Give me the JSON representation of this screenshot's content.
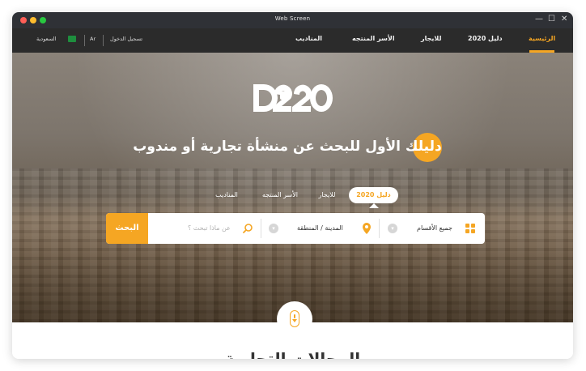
{
  "window": {
    "title": "Web Screen",
    "controls": {
      "minimize": "—",
      "maximize": "☐",
      "close": "✕"
    },
    "traffic_lights": {
      "red": "#ff5f57",
      "yellow": "#febc2e",
      "green": "#28c840"
    }
  },
  "nav": {
    "items": [
      {
        "label": "الرئيسية",
        "active": true
      },
      {
        "label": "دليل 2020",
        "active": false
      },
      {
        "label": "للايجار",
        "active": false
      },
      {
        "label": "الأسر المنتجه",
        "active": false
      },
      {
        "label": "المناديب",
        "active": false
      }
    ],
    "login": "تسجيل الدخول",
    "language": "Ar",
    "country": "السعودية"
  },
  "hero": {
    "logo_text": "D2020",
    "headline": "دليلك الأول للبحث عن منشأة تجارية أو مندوب",
    "tabs": [
      {
        "label": "دليل 2020",
        "active": true
      },
      {
        "label": "للايجار",
        "active": false
      },
      {
        "label": "الأسر المنتجه",
        "active": false
      },
      {
        "label": "المناديب",
        "active": false
      }
    ]
  },
  "search": {
    "categories": "جميع الأقسام",
    "city": "المدينة / المنطقة",
    "placeholder": "عن ماذا تبحث ؟",
    "button": "البحث"
  },
  "section": {
    "title": "المجالات التجارية"
  },
  "colors": {
    "accent": "#f5a623",
    "nav_bg": "#2b2b2b",
    "titlebar_bg": "#2f3136"
  }
}
